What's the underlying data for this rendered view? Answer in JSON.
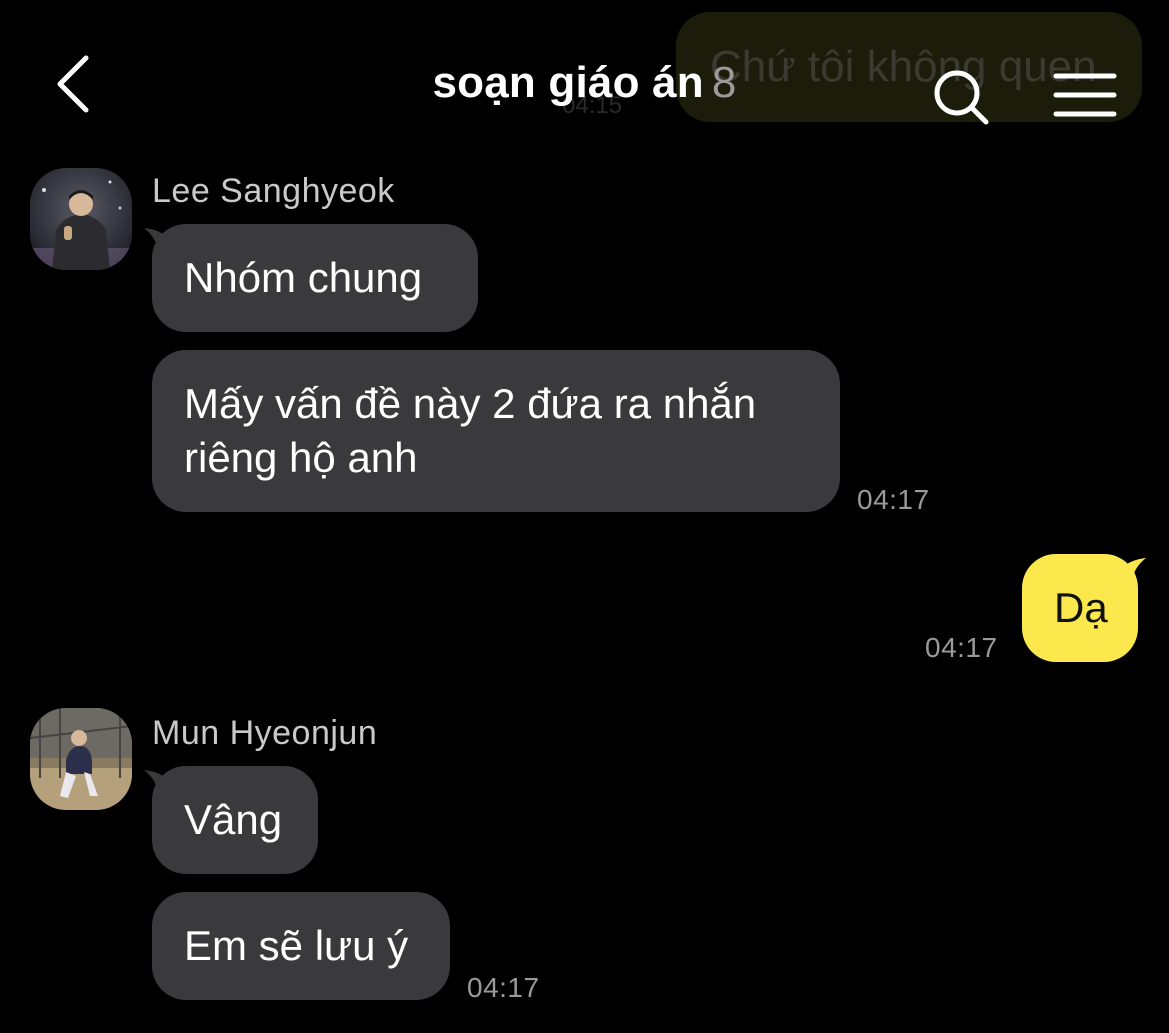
{
  "header": {
    "title": "soạn giáo án",
    "member_count": "8"
  },
  "ghost": {
    "text": "Chứ tôi không quen",
    "time": "04:15"
  },
  "messages": [
    {
      "sender": "Lee Sanghyeok",
      "bubbles": [
        "Nhóm chung",
        "Mấy vấn đề này 2 đứa ra nhắn",
        "riêng hộ anh"
      ],
      "time": "04:17"
    },
    {
      "sender": "me",
      "bubbles": [
        "Dạ"
      ],
      "time": "04:17"
    },
    {
      "sender": "Mun Hyeonjun",
      "bubbles": [
        "Vâng",
        "Em sẽ lưu ý"
      ],
      "time": "04:17"
    }
  ],
  "colors": {
    "background": "#000000",
    "incoming_bubble": "#3a3a3c",
    "outgoing_bubble": "#fae84c",
    "timestamp": "#9a9a9a"
  },
  "icons": [
    "back-arrow-icon",
    "search-icon",
    "menu-icon"
  ]
}
